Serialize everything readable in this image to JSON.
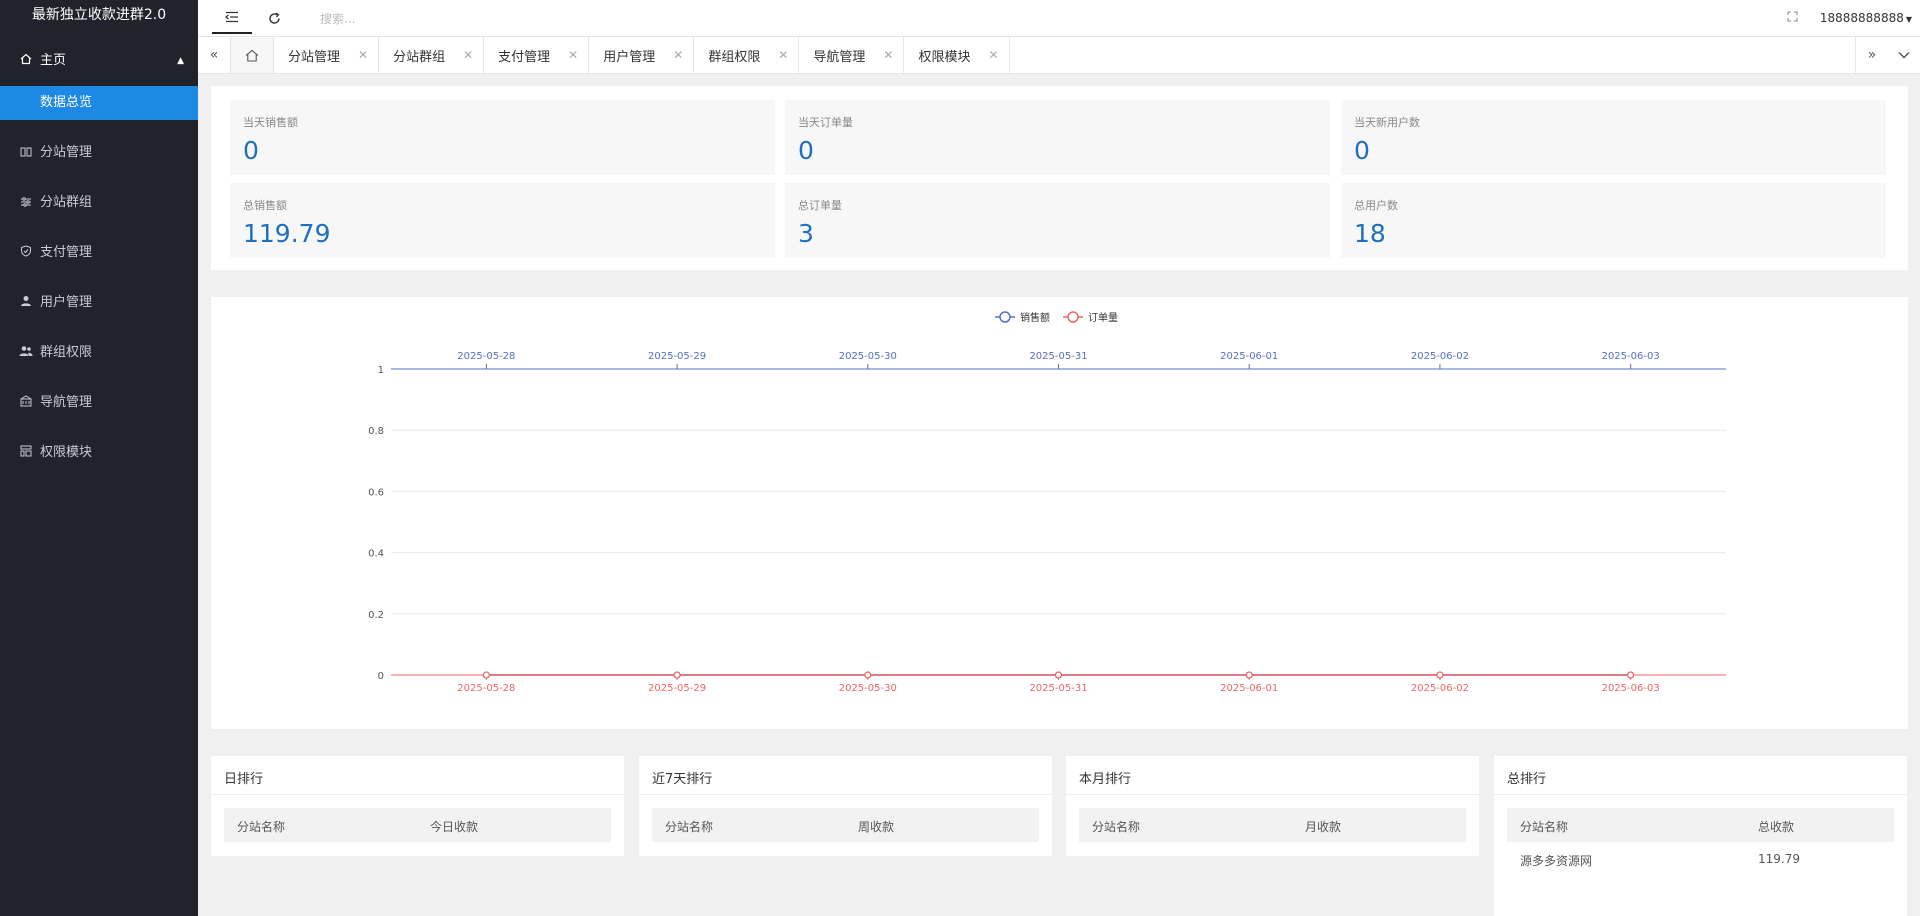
{
  "sidebar": {
    "brand": "最新独立收款进群2.0",
    "home": {
      "label": "主页",
      "icon": "home-icon"
    },
    "active_sub": "数据总览",
    "items": [
      {
        "label": "分站管理",
        "icon": "columns-icon"
      },
      {
        "label": "分站群组",
        "icon": "sliders-icon"
      },
      {
        "label": "支付管理",
        "icon": "shield-icon"
      },
      {
        "label": "用户管理",
        "icon": "user-icon"
      },
      {
        "label": "群组权限",
        "icon": "users-icon"
      },
      {
        "label": "导航管理",
        "icon": "bank-icon"
      },
      {
        "label": "权限模块",
        "icon": "modules-icon"
      }
    ]
  },
  "topbar": {
    "search_placeholder": "搜索...",
    "user": "18888888888"
  },
  "tabs": [
    "分站管理",
    "分站群组",
    "支付管理",
    "用户管理",
    "群组权限",
    "导航管理",
    "权限模块"
  ],
  "stats": [
    {
      "label": "当天销售额",
      "value": "0"
    },
    {
      "label": "当天订单量",
      "value": "0"
    },
    {
      "label": "当天新用户数",
      "value": "0"
    },
    {
      "label": "总销售额",
      "value": "119.79"
    },
    {
      "label": "总订单量",
      "value": "3"
    },
    {
      "label": "总用户数",
      "value": "18"
    }
  ],
  "chart_data": {
    "type": "line",
    "x": [
      "2025-05-28",
      "2025-05-29",
      "2025-05-30",
      "2025-05-31",
      "2025-06-01",
      "2025-06-02",
      "2025-06-03"
    ],
    "series": [
      {
        "name": "销售额",
        "values": [
          0,
          0,
          0,
          0,
          0,
          0,
          0
        ],
        "color": "#5470c6",
        "axis": "top"
      },
      {
        "name": "订单量",
        "values": [
          0,
          0,
          0,
          0,
          0,
          0,
          0
        ],
        "color": "#ee6666",
        "axis": "bottom"
      }
    ],
    "ylim": [
      0,
      1
    ],
    "yticks": [
      "0",
      "0.2",
      "0.4",
      "0.6",
      "0.8",
      "1"
    ],
    "grid": true,
    "legend": "top-center"
  },
  "rankings": [
    {
      "title": "日排行",
      "col1": "分站名称",
      "col2": "今日收款",
      "rows": []
    },
    {
      "title": "近7天排行",
      "col1": "分站名称",
      "col2": "周收款",
      "rows": []
    },
    {
      "title": "本月排行",
      "col1": "分站名称",
      "col2": "月收款",
      "rows": []
    },
    {
      "title": "总排行",
      "col1": "分站名称",
      "col2": "总收款",
      "rows": [
        {
          "name": "源多多资源网",
          "amount": "119.79"
        }
      ]
    }
  ],
  "colors": {
    "sidebar": "#20232b",
    "accent": "#1e88e5",
    "stat_value": "#1e6fbe"
  }
}
